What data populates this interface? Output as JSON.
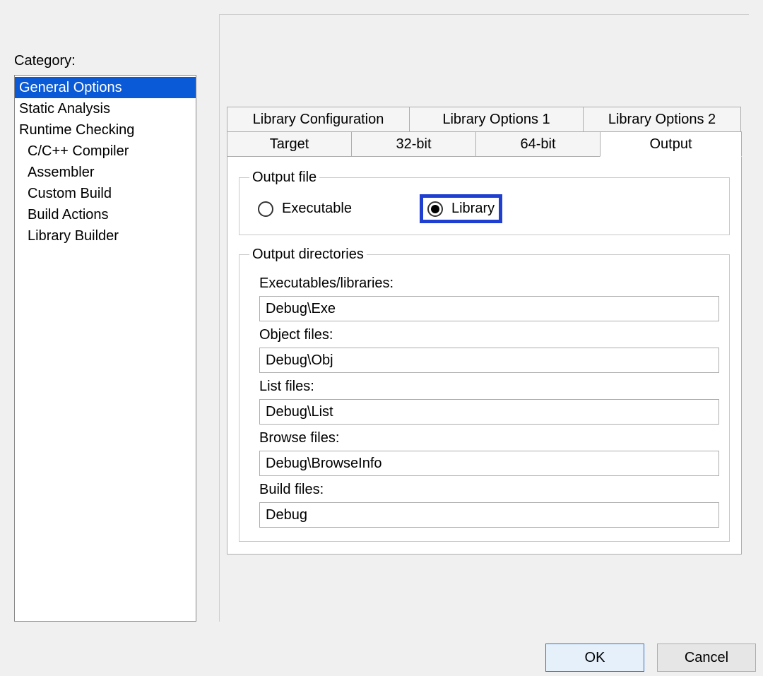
{
  "category_label": "Category:",
  "categories": [
    {
      "label": "General Options",
      "indent": false,
      "selected": true
    },
    {
      "label": "Static Analysis",
      "indent": false,
      "selected": false
    },
    {
      "label": "Runtime Checking",
      "indent": false,
      "selected": false
    },
    {
      "label": "C/C++ Compiler",
      "indent": true,
      "selected": false
    },
    {
      "label": "Assembler",
      "indent": true,
      "selected": false
    },
    {
      "label": "Custom Build",
      "indent": true,
      "selected": false
    },
    {
      "label": "Build Actions",
      "indent": true,
      "selected": false
    },
    {
      "label": "Library Builder",
      "indent": true,
      "selected": false
    }
  ],
  "tabs_upper": [
    {
      "label": "Library Configuration"
    },
    {
      "label": "Library Options 1"
    },
    {
      "label": "Library Options 2"
    }
  ],
  "tabs_lower": [
    {
      "label": "Target",
      "active": false
    },
    {
      "label": "32-bit",
      "active": false
    },
    {
      "label": "64-bit",
      "active": false
    },
    {
      "label": "Output",
      "active": true
    }
  ],
  "output_file": {
    "legend": "Output file",
    "executable_label": "Executable",
    "library_label": "Library",
    "selected": "library"
  },
  "output_dirs": {
    "legend": "Output directories",
    "fields": [
      {
        "label": "Executables/libraries:",
        "value": "Debug\\Exe"
      },
      {
        "label": "Object files:",
        "value": "Debug\\Obj"
      },
      {
        "label": "List files:",
        "value": "Debug\\List"
      },
      {
        "label": "Browse files:",
        "value": "Debug\\BrowseInfo"
      },
      {
        "label": "Build files:",
        "value": "Debug"
      }
    ]
  },
  "buttons": {
    "ok": "OK",
    "cancel": "Cancel"
  }
}
